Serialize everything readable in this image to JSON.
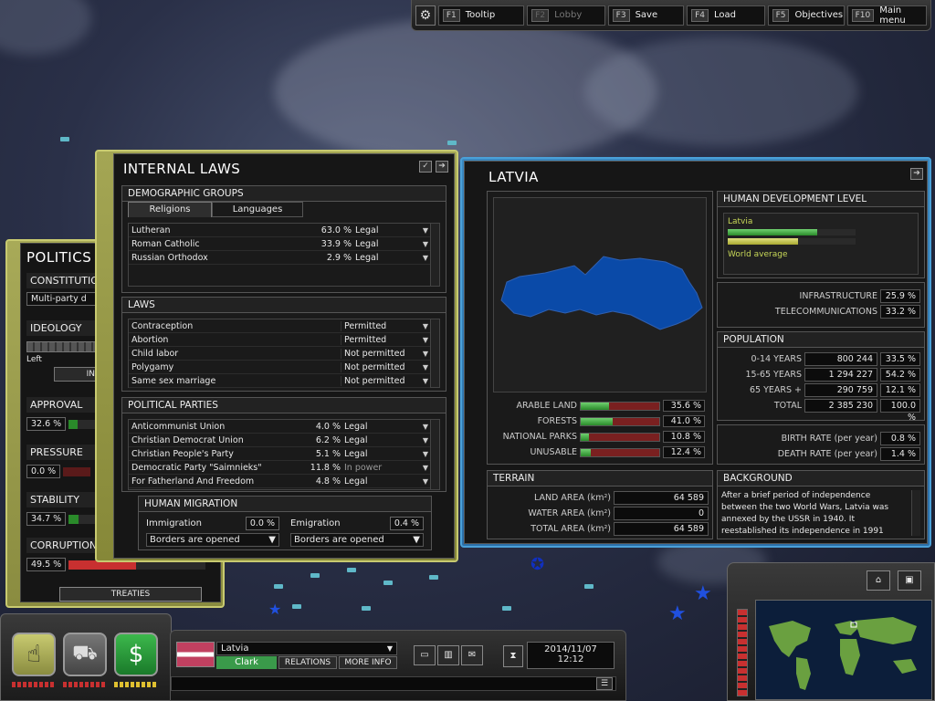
{
  "topbar": {
    "keys": [
      {
        "key": "F1",
        "label": "Tooltip",
        "disabled": false
      },
      {
        "key": "F2",
        "label": "Lobby",
        "disabled": true
      },
      {
        "key": "F3",
        "label": "Save",
        "disabled": false
      },
      {
        "key": "F4",
        "label": "Load",
        "disabled": false
      },
      {
        "key": "F5",
        "label": "Objectives",
        "disabled": false
      },
      {
        "key": "F10",
        "label": "Main menu",
        "disabled": false
      }
    ]
  },
  "politics": {
    "title": "POLITICS",
    "constitution_label": "CONSTITUTIONAL",
    "constitution_value": "Multi-party d",
    "ideology_label": "IDEOLOGY",
    "ideology_left": "Left",
    "ideology_button": "IN",
    "approval_label": "APPROVAL",
    "approval_value": "32.6 %",
    "approval_level": 0.326,
    "pressure_label": "PRESSURE",
    "pressure_value": "0.0 %",
    "stability_label": "STABILITY",
    "stability_value": "34.7 %",
    "stability_level": 0.347,
    "corruption_label": "CORRUPTION",
    "corruption_value": "49.5 %",
    "corruption_level": 0.495,
    "treaties_button": "TREATIES"
  },
  "laws": {
    "title": "INTERNAL LAWS",
    "demographic_head": "DEMOGRAPHIC GROUPS",
    "tabs": [
      "Religions",
      "Languages"
    ],
    "religions": [
      {
        "name": "Lutheran",
        "pct": "63.0 %",
        "status": "Legal"
      },
      {
        "name": "Roman Catholic",
        "pct": "33.9 %",
        "status": "Legal"
      },
      {
        "name": "Russian Orthodox",
        "pct": "2.9 %",
        "status": "Legal"
      }
    ],
    "laws_head": "LAWS",
    "laws": [
      {
        "name": "Contraception",
        "status": "Permitted"
      },
      {
        "name": "Abortion",
        "status": "Permitted"
      },
      {
        "name": "Child labor",
        "status": "Not permitted"
      },
      {
        "name": "Polygamy",
        "status": "Not permitted"
      },
      {
        "name": "Same sex marriage",
        "status": "Not permitted"
      }
    ],
    "parties_head": "POLITICAL PARTIES",
    "parties": [
      {
        "name": "Anticommunist Union",
        "pct": "4.0 %",
        "status": "Legal"
      },
      {
        "name": "Christian Democrat Union",
        "pct": "6.2 %",
        "status": "Legal"
      },
      {
        "name": "Christian People's Party",
        "pct": "5.1 %",
        "status": "Legal"
      },
      {
        "name": "Democratic Party \"Saimnieks\"",
        "pct": "11.8 %",
        "status": "In power"
      },
      {
        "name": "For Fatherland And Freedom",
        "pct": "4.8 %",
        "status": "Legal"
      }
    ],
    "migration_head": "HUMAN MIGRATION",
    "immigration_label": "Immigration",
    "immigration_value": "0.0 %",
    "immigration_policy": "Borders are opened",
    "emigration_label": "Emigration",
    "emigration_value": "0.4 %",
    "emigration_policy": "Borders are opened"
  },
  "latvia": {
    "title": "LATVIA",
    "land_use": [
      {
        "label": "ARABLE LAND",
        "value": "35.6 %",
        "level": 0.356
      },
      {
        "label": "FORESTS",
        "value": "41.0 %",
        "level": 0.41
      },
      {
        "label": "NATIONAL PARKS",
        "value": "10.8 %",
        "level": 0.108
      },
      {
        "label": "UNUSABLE",
        "value": "12.4 %",
        "level": 0.124
      }
    ],
    "hdl_head": "HUMAN DEVELOPMENT LEVEL",
    "hdl_country": "Latvia",
    "hdl_country_level": 0.7,
    "hdl_world": "World average",
    "hdl_world_level": 0.55,
    "infra": [
      {
        "label": "INFRASTRUCTURE",
        "value": "25.9 %"
      },
      {
        "label": "TELECOMMUNICATIONS",
        "value": "33.2 %"
      }
    ],
    "pop_head": "POPULATION",
    "population": [
      {
        "label": "0-14 YEARS",
        "count": "800 244",
        "pct": "33.5 %"
      },
      {
        "label": "15-65 YEARS",
        "count": "1 294 227",
        "pct": "54.2 %"
      },
      {
        "label": "65 YEARS +",
        "count": "290 759",
        "pct": "12.1 %"
      },
      {
        "label": "TOTAL",
        "count": "2 385 230",
        "pct": "100.0 %"
      }
    ],
    "rates": [
      {
        "label": "BIRTH RATE (per year)",
        "value": "0.8 %"
      },
      {
        "label": "DEATH RATE (per year)",
        "value": "1.4 %"
      }
    ],
    "terrain_head": "TERRAIN",
    "terrain": [
      {
        "label": "LAND AREA (km²)",
        "value": "64 589"
      },
      {
        "label": "WATER AREA (km²)",
        "value": "0"
      },
      {
        "label": "TOTAL AREA (km²)",
        "value": "64 589"
      }
    ],
    "background_head": "BACKGROUND",
    "background_text": "After a brief period of independence between the two World Wars, Latvia was annexed by the USSR in 1940. It reestablished its independence in 1991"
  },
  "hud": {
    "country": "Latvia",
    "leader": "Clark",
    "relations": "RELATIONS",
    "more_info": "MORE INFO",
    "date": "2014/11/07",
    "time": "12:12"
  },
  "colors": {
    "politics_frame": "#a8aa58",
    "latvia_frame": "#3a88c0",
    "country_shape": "#0a4aa8",
    "approval_green": "#2a8a2a",
    "corruption_red": "#c83030",
    "flag_red": "#c04060"
  }
}
